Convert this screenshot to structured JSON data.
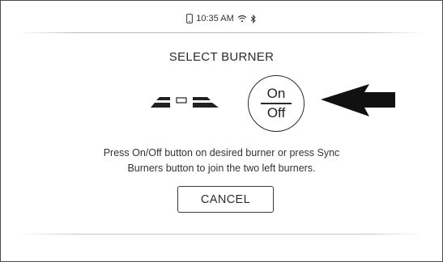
{
  "status_bar": {
    "time": "10:35 AM",
    "icons": [
      "phone-icon",
      "wifi-icon",
      "bluetooth-icon"
    ]
  },
  "screen": {
    "title": "SELECT BURNER",
    "onoff_button": {
      "on_label": "On",
      "off_label": "Off"
    },
    "instructions_line1": "Press On/Off button on desired burner or press Sync",
    "instructions_line2": "Burners button to join the two left burners.",
    "cancel_label": "CANCEL"
  },
  "colors": {
    "text": "#2b2b2b",
    "border": "#4a4a4a",
    "background": "#ffffff"
  }
}
